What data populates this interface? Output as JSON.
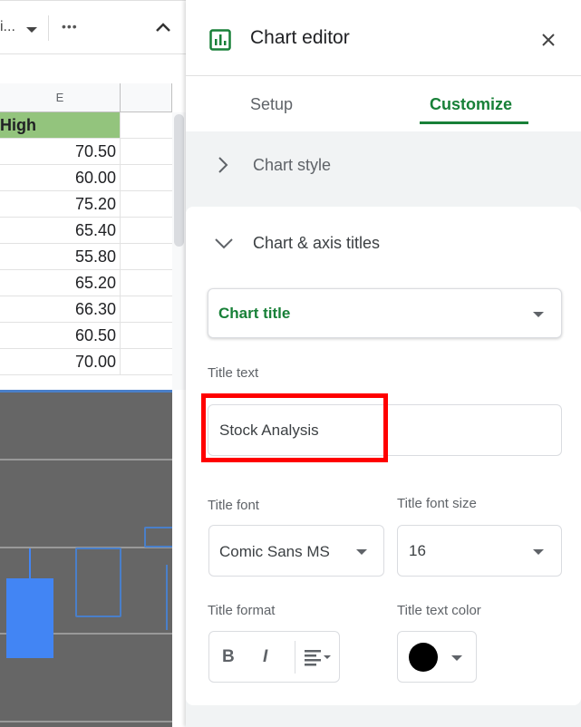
{
  "toolbar": {
    "truncated_label": "i...",
    "more_label": "•••"
  },
  "sheet": {
    "column_header": "E",
    "header_cell": "High",
    "values": [
      "70.50",
      "60.00",
      "75.20",
      "65.40",
      "55.80",
      "65.20",
      "66.30",
      "60.50",
      "70.00"
    ]
  },
  "chart": {
    "series_color": "#4285f4",
    "background": "#666666"
  },
  "editor": {
    "title": "Chart editor",
    "tabs": [
      "Setup",
      "Customize"
    ],
    "active_tab": "Customize",
    "sections": {
      "chart_style": "Chart style",
      "chart_axis_titles": "Chart & axis titles"
    },
    "title_target": "Chart title",
    "title_text_label": "Title text",
    "title_text_value": "Stock Analysis",
    "title_font_label": "Title font",
    "title_font_value": "Comic Sans MS",
    "title_font_size_label": "Title font size",
    "title_font_size_value": "16",
    "title_format_label": "Title format",
    "bold": "B",
    "italic": "I",
    "title_text_color_label": "Title text color",
    "title_text_color": "#000000",
    "accent": "#188038"
  }
}
